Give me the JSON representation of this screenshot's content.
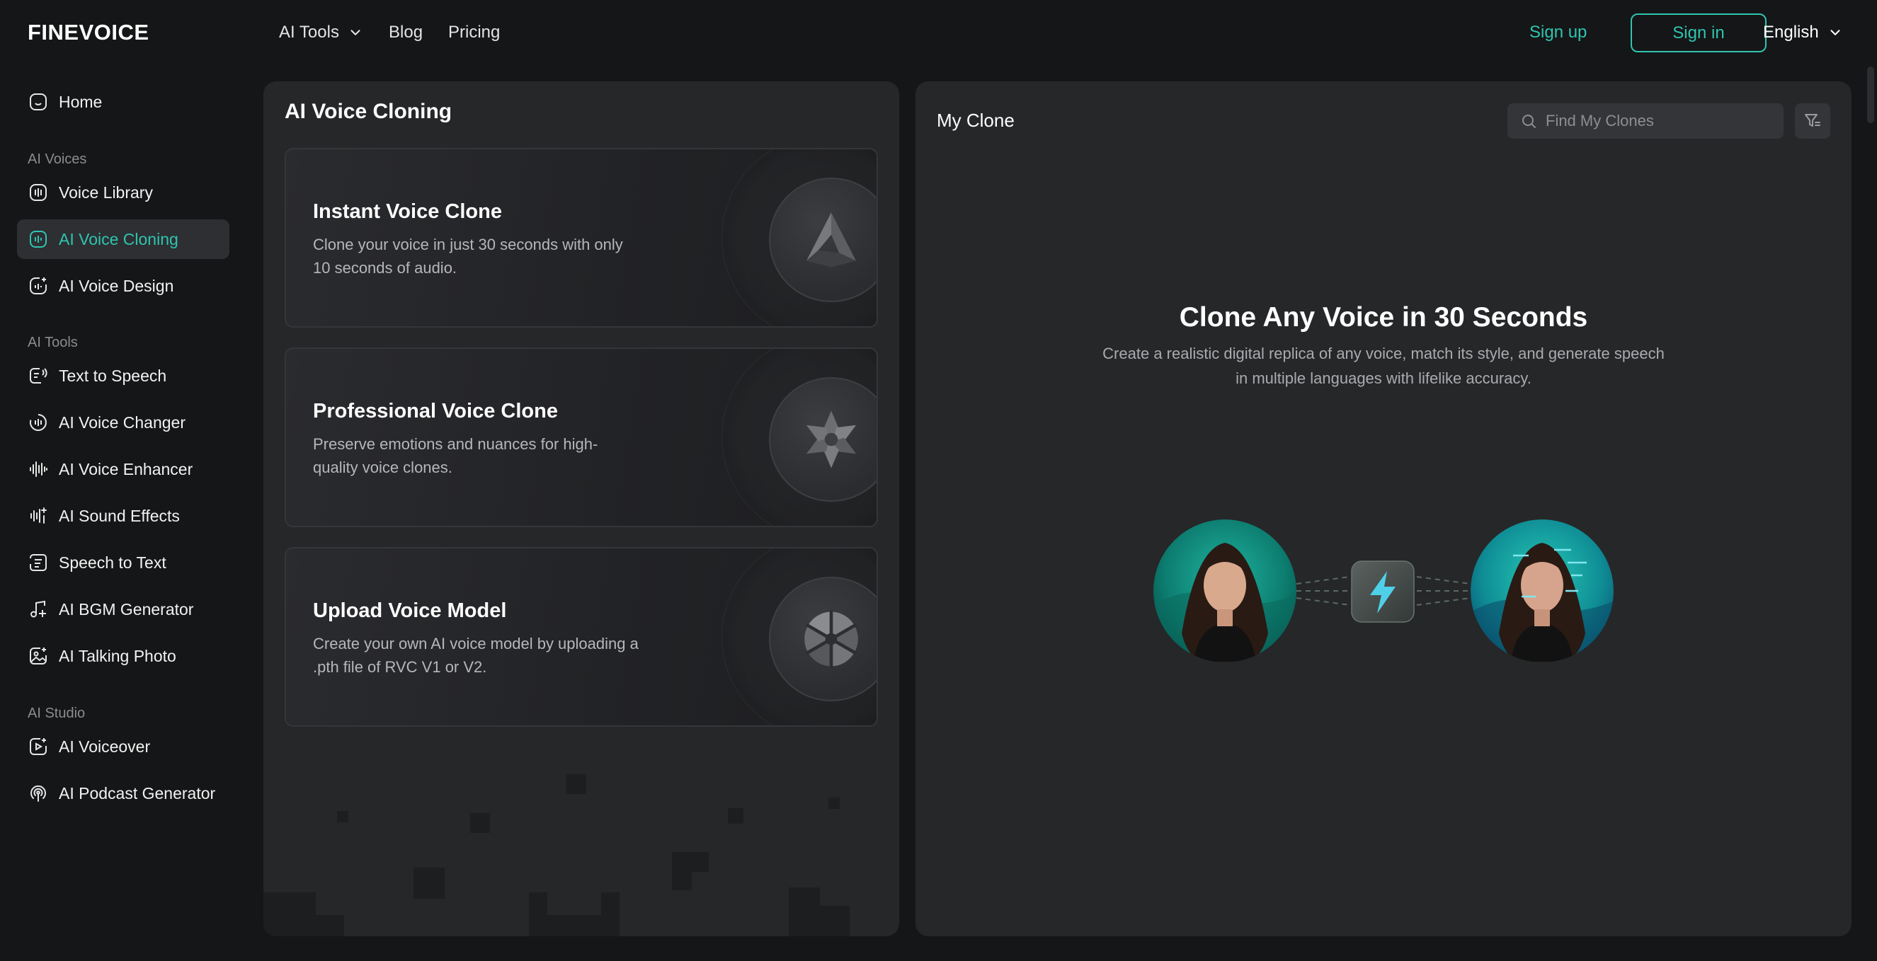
{
  "brand": {
    "logo": "FINEVOICE"
  },
  "nav": {
    "ai_tools": "AI Tools",
    "blog": "Blog",
    "pricing": "Pricing",
    "sign_up": "Sign up",
    "sign_in": "Sign in",
    "language": "English"
  },
  "sidebar": {
    "home": "Home",
    "section_voices": "AI Voices",
    "voice_library": "Voice Library",
    "ai_voice_cloning": "AI Voice Cloning",
    "ai_voice_design": "AI Voice Design",
    "section_tools": "AI Tools",
    "text_to_speech": "Text to Speech",
    "ai_voice_changer": "AI Voice Changer",
    "ai_voice_enhancer": "AI Voice Enhancer",
    "ai_sound_effects": "AI Sound Effects",
    "speech_to_text": "Speech to Text",
    "ai_bgm_generator": "AI BGM Generator",
    "ai_talking_photo": "AI Talking Photo",
    "section_studio": "AI Studio",
    "ai_voiceover": "AI Voiceover",
    "ai_podcast_generator": "AI Podcast Generator",
    "active_item": "AI Voice Cloning"
  },
  "cloning_panel": {
    "title": "AI Voice Cloning",
    "cards": [
      {
        "title": "Instant Voice Clone",
        "description": "Clone your voice in just 30 seconds with only 10 seconds of audio.",
        "icon": "triangle-logo-icon"
      },
      {
        "title": "Professional Voice Clone",
        "description": "Preserve emotions and nuances for high-quality voice clones.",
        "icon": "flower-star-icon"
      },
      {
        "title": "Upload Voice Model",
        "description": "Create your own AI voice model by uploading a .pth file of RVC V1 or V2.",
        "icon": "pinwheel-icon"
      }
    ]
  },
  "my_clone": {
    "title": "My Clone",
    "search_placeholder": "Find My Clones",
    "hero_title": "Clone Any Voice in 30 Seconds",
    "hero_description": "Create a realistic digital replica of any voice, match its style, and generate speech in multiple languages with lifelike accuracy."
  },
  "colors": {
    "accent": "#2fc4b0",
    "background": "#151617",
    "panel": "#262729",
    "active_item_bg": "#2d2f32",
    "lightning_blue": "#4fd0e8"
  }
}
